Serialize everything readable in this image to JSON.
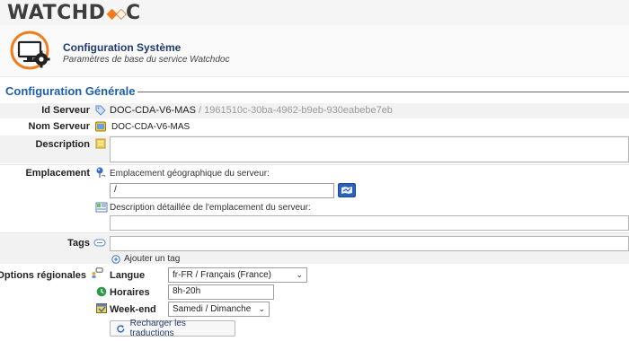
{
  "brand": {
    "logo_prefix": "WATCHD",
    "logo_mark": "◆◇",
    "logo_suffix": "C"
  },
  "header": {
    "title": "Configuration Système",
    "subtitle": "Paramètres de base du service Watchdoc",
    "icon": "monitor-gear-icon"
  },
  "section": {
    "title": "Configuration Générale"
  },
  "fields": {
    "server_id": {
      "label": "Id Serveur",
      "name": "DOC-CDA-V6-MAS",
      "separator": " / ",
      "guid": "1961510c-30ba-4962-b9eb-930eabebe7eb"
    },
    "server_name": {
      "label": "Nom Serveur",
      "value": "DOC-CDA-V6-MAS"
    },
    "description": {
      "label": "Description",
      "value": ""
    },
    "location": {
      "label": "Emplacement",
      "geo_label": "Emplacement géographique du serveur:",
      "geo_value": "/",
      "detail_label": "Description détaillée de l'emplacement du serveur:",
      "detail_value": ""
    },
    "tags": {
      "label": "Tags",
      "value": "",
      "add_label": "Ajouter un tag"
    },
    "regional": {
      "label": "Options régionales",
      "language_label": "Langue",
      "language_value": "fr-FR / Français (France)",
      "hours_label": "Horaires",
      "hours_value": "8h-20h",
      "weekend_label": "Week-end",
      "weekend_value": "Samedi / Dimanche",
      "reload_button": "Recharger les traductions"
    }
  },
  "colors": {
    "accent_orange": "#f07c1d",
    "section_blue": "#1f5fa8",
    "title_navy": "#1f3a6e",
    "alt_row": "#f2f2f2"
  }
}
